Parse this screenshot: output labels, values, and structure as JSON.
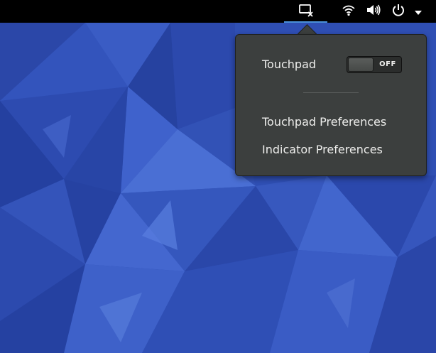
{
  "topbar": {
    "touchpad_icon": "touchpad-disabled-icon",
    "wifi_icon": "wifi-icon",
    "volume_icon": "volume-icon",
    "power_icon": "power-icon",
    "menu_icon": "dropdown-triangle-icon"
  },
  "menu": {
    "touchpad_label": "Touchpad",
    "toggle_state": "OFF",
    "items": [
      {
        "label": "Touchpad Preferences"
      },
      {
        "label": "Indicator Preferences"
      }
    ]
  },
  "colors": {
    "menu_bg": "#3c3f3e",
    "menu_text": "#eeeeec",
    "accent": "#4a90d9",
    "wallpaper": "#2f4fb4"
  }
}
